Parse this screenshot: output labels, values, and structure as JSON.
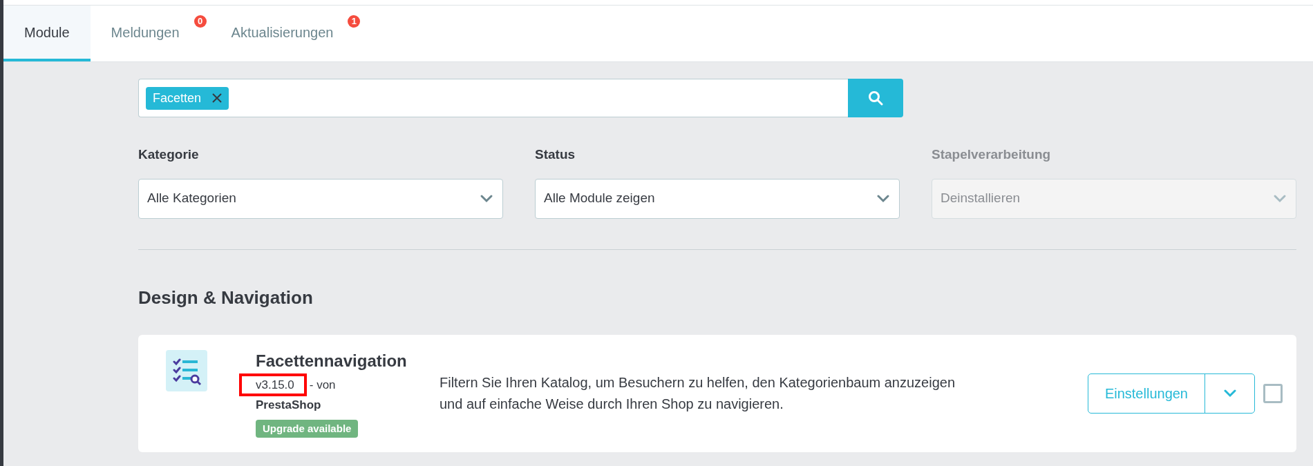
{
  "tabs": [
    {
      "label": "Module",
      "selected": true
    },
    {
      "label": "Meldungen",
      "selected": false,
      "badge": "0"
    },
    {
      "label": "Aktualisierungen",
      "selected": false,
      "badge": "1"
    }
  ],
  "search": {
    "tags": [
      "Facetten"
    ]
  },
  "filters": [
    {
      "label": "Kategorie",
      "value": "Alle Kategorien",
      "disabled": false
    },
    {
      "label": "Status",
      "value": "Alle Module zeigen",
      "disabled": false
    },
    {
      "label": "Stapelverarbeitung",
      "value": "Deinstallieren",
      "disabled": true
    }
  ],
  "section": {
    "title": "Design & Navigation"
  },
  "modules": [
    {
      "name": "Facettennavigation",
      "version": "v3.15.0",
      "by": "- von",
      "version_highlighted": true,
      "author": "PrestaShop",
      "badge": "Upgrade available",
      "description": "Filtern Sie Ihren Katalog, um Besuchern zu helfen, den Kategorienbaum anzuzeigen und auf einfache Weise durch Ihren Shop zu navigieren.",
      "action": "Einstellungen",
      "checked": false
    }
  ]
}
